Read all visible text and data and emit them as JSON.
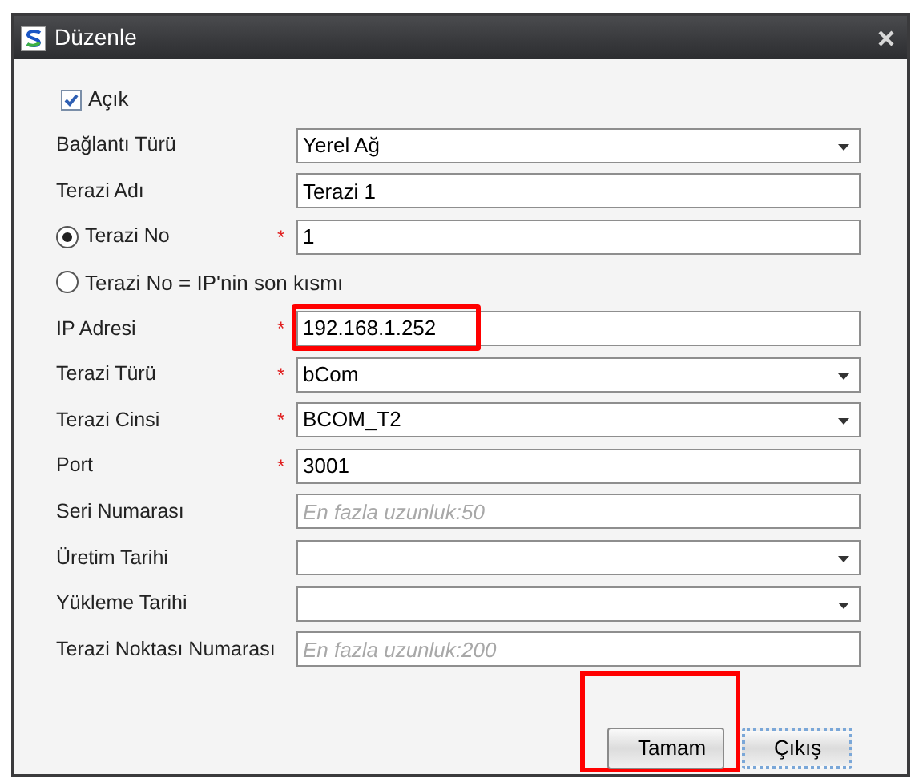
{
  "window": {
    "title": "Düzenle"
  },
  "rows": [
    {
      "kind": "checkbox",
      "label": "Açık",
      "checked": true
    },
    {
      "kind": "select",
      "label": "Bağlantı Türü",
      "value": "Yerel Ağ"
    },
    {
      "kind": "text",
      "label": "Terazi Adı",
      "value": "Terazi 1"
    },
    {
      "kind": "radio",
      "label": "Terazi No",
      "selected": true,
      "mark": "*",
      "value": "1"
    },
    {
      "kind": "radio",
      "label": "Terazi No = IP'nin son kısmı",
      "selected": false
    },
    {
      "kind": "text",
      "label": "IP Adresi",
      "mark": "*",
      "value": "192.168.1.252",
      "highlighted": true
    },
    {
      "kind": "select",
      "label": "Terazi Türü",
      "mark": "*",
      "value": "bCom"
    },
    {
      "kind": "select",
      "label": "Terazi Cinsi",
      "mark": "*",
      "value": "BCOM_T2"
    },
    {
      "kind": "text",
      "label": "Port",
      "mark": "*",
      "value": "3001"
    },
    {
      "kind": "text",
      "label": "Seri Numarası",
      "placeholder": "En fazla uzunluk:50"
    },
    {
      "kind": "select",
      "label": "Üretim Tarihi"
    },
    {
      "kind": "select",
      "label": "Yükleme Tarihi"
    },
    {
      "kind": "text",
      "label": "Terazi Noktası Numarası",
      "placeholder": "En fazla uzunluk:200"
    }
  ],
  "buttons": [
    {
      "label": "Tamam",
      "highlighted": true,
      "focused": false
    },
    {
      "label": "Çıkış",
      "highlighted": false,
      "focused": true
    }
  ]
}
